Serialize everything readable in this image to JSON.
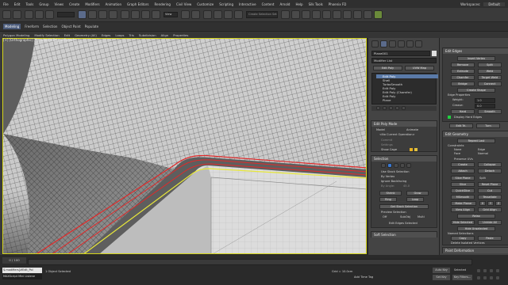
{
  "menubar": {
    "items": [
      "File",
      "Edit",
      "Tools",
      "Group",
      "Views",
      "Create",
      "Modifiers",
      "Animation",
      "Graph Editors",
      "Rendering",
      "Civil View",
      "Customize",
      "Scripting",
      "Interactive",
      "Content",
      "Arnold",
      "Help",
      "Silk Tools",
      "Phoenix FD"
    ],
    "workspaces_label": "Workspaces:",
    "workspace_value": "Default"
  },
  "toolbar": {
    "selection_set_placeholder": "Create Selection Set",
    "view_dropdown": "View"
  },
  "ribbon": {
    "tabs": [
      "Modeling",
      "Freeform",
      "Selection",
      "Object Paint",
      "Populate"
    ],
    "active_tab": "Modeling",
    "groups": [
      "Polygon Modeling",
      "Modify Selection",
      "Edit",
      "Geometry (All)",
      "Edges",
      "Loops",
      "Tris",
      "Subdivision",
      "Align",
      "Properties"
    ]
  },
  "viewport": {
    "label": "[+] [Orthographic] [Standard] [Edged Faces]"
  },
  "cmd": {
    "object_name": "Plane001",
    "modifier_list": "Modifier List",
    "stack": [
      "Edit Poly",
      "Shell",
      "TurboSmooth",
      "Edit Poly",
      "Edit Poly (Chamfer)",
      "Edit Poly",
      "Plane"
    ],
    "selected_index": 0,
    "btn_edit_poly": "Edit Poly",
    "btn_uvw_map": "UVW Map",
    "edit_poly_mode": "Edit Poly Mode",
    "model": "Model",
    "animate": "Animate",
    "no_current_op": "<No Current Operation>",
    "commit": "Commit",
    "settings": "Settings",
    "cancel": "Cancel",
    "show_cage": "Show Cage",
    "selection": "Selection",
    "use_stack_selection": "Use Stack Selection",
    "by_vertex": "By Vertex",
    "ignore_backfacing": "Ignore Backfacing",
    "by_angle": "By Angle:",
    "by_angle_val": "45.0",
    "shrink": "Shrink",
    "grow": "Grow",
    "ring": "Ring",
    "loop": "Loop",
    "get_stack_selection": "Get Stack Selection",
    "preview_selection": "Preview Selection",
    "off": "Off",
    "subobj": "SubObj",
    "multi": "Multi",
    "edit_edges_selected": "Edit Edges Selected",
    "soft_selection": "Soft Selection"
  },
  "side": {
    "edit_edges": "Edit Edges",
    "insert_vertex": "Insert Vertex",
    "remove": "Remove",
    "split": "Split",
    "extrude": "Extrude",
    "weld": "Weld",
    "chamfer": "Chamfer",
    "target_weld": "Target Weld",
    "bridge": "Bridge",
    "connect": "Connect",
    "create_shape": "Create Shape",
    "edge_properties": "Edge Properties",
    "weight": "Weight:",
    "weight_val": "1.0",
    "crease": "Crease:",
    "crease_val": "0.0",
    "hard": "Hard",
    "smooth": "Smooth",
    "display_hard_edges": "Display Hard Edges",
    "edit_tri": "Edit Tri.",
    "turn": "Turn",
    "edit_geometry": "Edit Geometry",
    "repeat_last": "Repeat Last",
    "constraints": "Constraints",
    "none": "None",
    "edge": "Edge",
    "face": "Face",
    "normal": "Normal",
    "preserve_uvs": "Preserve UVs",
    "create": "Create",
    "collapse": "Collapse",
    "attach": "Attach",
    "detach": "Detach",
    "slice_plane": "Slice Plane",
    "split2": "Split",
    "slice": "Slice",
    "reset_plane": "Reset Plane",
    "quickslice": "QuickSlice",
    "cut": "Cut",
    "msmooth": "MSmooth",
    "tessellate": "Tessellate",
    "make_planar": "Make Planar",
    "x": "X",
    "y": "Y",
    "z": "Z",
    "view_align": "View Align",
    "grid_align": "Grid Align",
    "relax": "Relax",
    "hide_selected": "Hide Selected",
    "unhide_all": "Unhide All",
    "hide_unselected": "Hide Unselected",
    "named_selections": "Named Selections",
    "copy": "Copy",
    "paste": "Paste",
    "delete_isolated": "Delete Isolated Vertices",
    "paint_deformation": "Paint Deformation"
  },
  "status": {
    "frame": "0 / 100",
    "objects_selected": "1 Object Selected",
    "script_line1": "$.modifiers[#Edit_Pol",
    "script_line2": "MAXScript Mini Listene",
    "grid": "Grid = 10.0cm",
    "add_time_tag": "Add Time Tag",
    "auto_key": "Auto Key",
    "selected": "Selected",
    "set_key": "Set Key",
    "key_filters": "Key Filters..."
  }
}
